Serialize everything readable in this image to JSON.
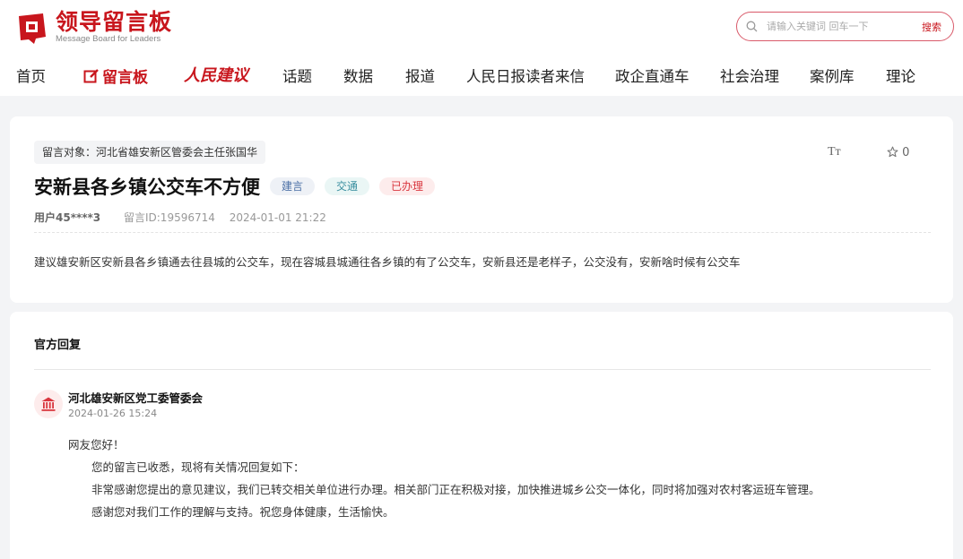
{
  "header": {
    "logo_title": "领导留言板",
    "logo_subtitle": "Message Board for Leaders",
    "search_placeholder": "请输入关键词 回车一下",
    "search_button": "搜索"
  },
  "nav": {
    "items": [
      "首页",
      "留言板",
      "人民建议",
      "话题",
      "数据",
      "报道",
      "人民日报读者来信",
      "政企直通车",
      "社会治理",
      "案例库",
      "理论"
    ]
  },
  "message": {
    "target": "留言对象：河北省雄安新区管委会主任张国华",
    "font_toggle": "Tт",
    "favorite_count": "0",
    "title": "安新县各乡镇公交车不方便",
    "tags": [
      "建言",
      "交通",
      "已办理"
    ],
    "user": "用户45****3",
    "message_id": "留言ID:19596714",
    "datetime": "2024-01-01 21:22",
    "content": "建议雄安新区安新县各乡镇通去往县城的公交车，现在容城县城通往各乡镇的有了公交车，安新县还是老样子，公交没有，安新啥时候有公交车"
  },
  "reply": {
    "heading": "官方回复",
    "org_name": "河北雄安新区党工委管委会",
    "date": "2024-01-26 15:24",
    "greeting": "网友您好！",
    "lines": [
      "您的留言已收悉，现将有关情况回复如下：",
      "非常感谢您提出的意见建议，我们已转交相关单位进行办理。相关部门正在积极对接，加快推进城乡公交一体化，同时将加强对农村客运班车管理。",
      "感谢您对我们工作的理解与支持。祝您身体健康，生活愉快。"
    ]
  },
  "colors": {
    "brand_red": "#c8161d",
    "background": "#f3f4f6"
  }
}
